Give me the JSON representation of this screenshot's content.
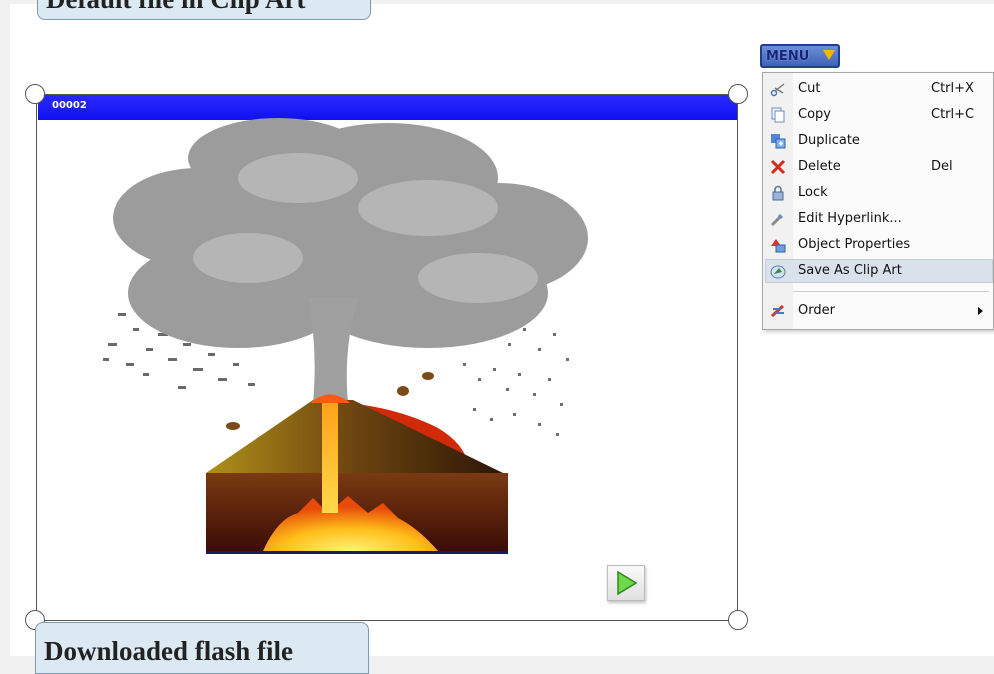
{
  "callouts": {
    "top": "Default file in Clip Art",
    "bottom": "Downloaded flash file"
  },
  "object": {
    "title": "00002",
    "image_subject": "volcano-eruption-illustration"
  },
  "menu": {
    "button_label": "MENU",
    "items": [
      {
        "label": "Cut",
        "shortcut": "Ctrl+X",
        "icon": "scissors-icon"
      },
      {
        "label": "Copy",
        "shortcut": "Ctrl+C",
        "icon": "copy-icon"
      },
      {
        "label": "Duplicate",
        "shortcut": "",
        "icon": "duplicate-icon"
      },
      {
        "label": "Delete",
        "shortcut": "Del",
        "icon": "delete-icon"
      },
      {
        "label": "Lock",
        "shortcut": "",
        "icon": "lock-icon"
      },
      {
        "label": "Edit Hyperlink...",
        "shortcut": "",
        "icon": "hyperlink-icon"
      },
      {
        "label": "Object Properties",
        "shortcut": "",
        "icon": "properties-icon"
      },
      {
        "label": "Save As Clip Art",
        "shortcut": "",
        "icon": "save-clip-art-icon",
        "selected": true
      },
      {
        "label": "Order",
        "shortcut": "",
        "icon": "order-icon",
        "submenu": true
      }
    ]
  },
  "colors": {
    "title_bar": "#1a1aff",
    "menu_selection": "#d9e1ea",
    "callout_bg": "#dbe9f3"
  }
}
